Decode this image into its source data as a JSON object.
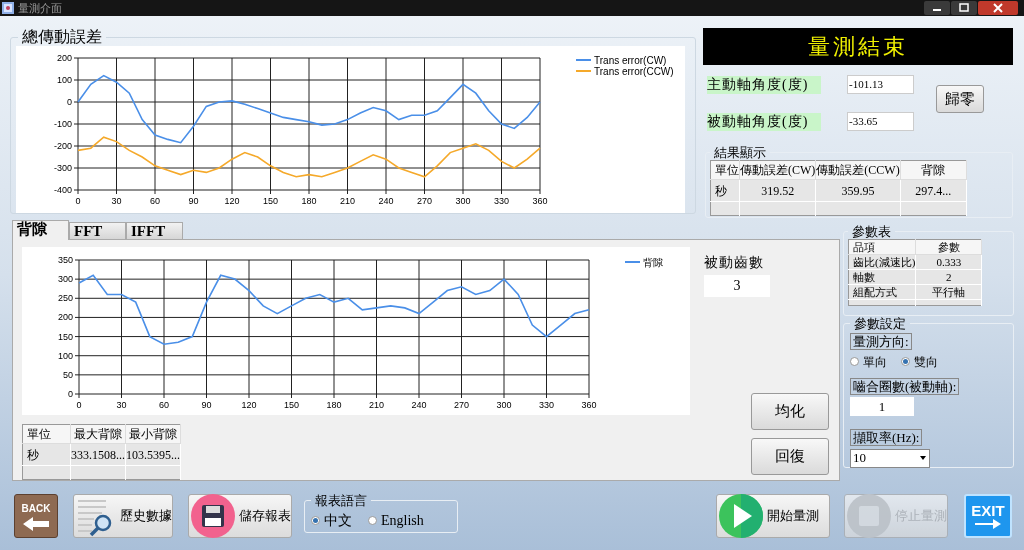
{
  "window": {
    "title": "量測介面"
  },
  "total_error": {
    "title": "總傳動誤差",
    "chart_data": {
      "type": "line",
      "grid": true,
      "legend": "right",
      "x": [
        0,
        10,
        20,
        30,
        40,
        50,
        60,
        70,
        80,
        90,
        100,
        110,
        120,
        130,
        140,
        150,
        160,
        170,
        180,
        190,
        200,
        210,
        220,
        230,
        240,
        250,
        260,
        270,
        280,
        290,
        300,
        310,
        320,
        330,
        340,
        350,
        360
      ],
      "xlim": [
        0,
        360
      ],
      "ylim": [
        -400,
        200
      ],
      "xticks": [
        0,
        30,
        60,
        90,
        120,
        150,
        180,
        210,
        240,
        270,
        300,
        330,
        360
      ],
      "yticks": [
        -400,
        -300,
        -200,
        -100,
        0,
        100,
        200
      ],
      "series": [
        {
          "name": "Trans error(CW)",
          "color": "#4a8fe8",
          "values": [
            0,
            80,
            120,
            90,
            40,
            -80,
            -150,
            -170,
            -185,
            -110,
            -20,
            0,
            5,
            -10,
            -30,
            -50,
            -70,
            -80,
            -90,
            -105,
            -100,
            -80,
            -50,
            -25,
            -40,
            -80,
            -60,
            -60,
            -40,
            20,
            80,
            40,
            -40,
            -100,
            -120,
            -70,
            0
          ]
        },
        {
          "name": "Trans error(CCW)",
          "color": "#f5a92a",
          "values": [
            -220,
            -210,
            -160,
            -180,
            -220,
            -250,
            -290,
            -310,
            -330,
            -310,
            -320,
            -300,
            -260,
            -230,
            -250,
            -290,
            -320,
            -340,
            -330,
            -340,
            -320,
            -300,
            -270,
            -240,
            -260,
            -300,
            -320,
            -340,
            -290,
            -230,
            -210,
            -190,
            -220,
            -270,
            -300,
            -260,
            -210
          ]
        }
      ]
    }
  },
  "status_banner": "量測結束",
  "angles": [
    {
      "label": "主動軸角度(度)",
      "value": "-101.13"
    },
    {
      "label": "被動軸角度(度)",
      "value": "-33.65"
    }
  ],
  "zero_button": "歸零",
  "results": {
    "title": "結果顯示",
    "columns": [
      "單位",
      "傳動誤差(CW)",
      "傳動誤差(CCW)",
      "背隙"
    ],
    "rows": [
      [
        "秒",
        "319.52",
        "359.95",
        "297.4..."
      ]
    ]
  },
  "tabs": [
    {
      "label": "背隙",
      "selected": true
    },
    {
      "label": "FFT",
      "selected": false
    },
    {
      "label": "IFFT",
      "selected": false
    }
  ],
  "backlash_chart": {
    "chart_data": {
      "type": "line",
      "grid": true,
      "legend": "right",
      "x": [
        0,
        10,
        20,
        30,
        40,
        50,
        60,
        70,
        80,
        90,
        100,
        110,
        120,
        130,
        140,
        150,
        160,
        170,
        180,
        190,
        200,
        210,
        220,
        230,
        240,
        250,
        260,
        270,
        280,
        290,
        300,
        310,
        320,
        330,
        340,
        350,
        360
      ],
      "xlim": [
        0,
        360
      ],
      "ylim": [
        0,
        350
      ],
      "xticks": [
        0,
        30,
        60,
        90,
        120,
        150,
        180,
        210,
        240,
        270,
        300,
        330,
        360
      ],
      "yticks": [
        0,
        50,
        100,
        150,
        200,
        250,
        300,
        350
      ],
      "series": [
        {
          "name": "背隙",
          "color": "#4a8fe8",
          "values": [
            290,
            310,
            260,
            260,
            240,
            150,
            130,
            135,
            150,
            240,
            310,
            300,
            270,
            230,
            210,
            230,
            250,
            260,
            240,
            250,
            220,
            225,
            230,
            225,
            210,
            240,
            270,
            280,
            260,
            270,
            300,
            260,
            180,
            150,
            180,
            210,
            220
          ]
        }
      ]
    }
  },
  "driven_teeth": {
    "label": "被動齒數",
    "value": "3"
  },
  "backlash_table": {
    "columns": [
      "單位",
      "最大背隙",
      "最小背隙"
    ],
    "rows": [
      [
        "秒",
        "333.1508...",
        "103.5395..."
      ]
    ]
  },
  "average_button": "均化",
  "restore_button": "回復",
  "param_table": {
    "title": "參數表",
    "columns": [
      "品項",
      "參數"
    ],
    "rows": [
      [
        "齒比(減速比)",
        "0.333"
      ],
      [
        "軸數",
        "2"
      ],
      [
        "組配方式",
        "平行軸"
      ]
    ]
  },
  "param_settings": {
    "title": "參數設定",
    "direction": {
      "label": "量測方向:",
      "options": [
        {
          "label": "單向",
          "selected": false
        },
        {
          "label": "雙向",
          "selected": true
        }
      ]
    },
    "mesh_turns": {
      "label": "嚙合圈數(被動軸):",
      "value": "1"
    },
    "sample_rate": {
      "label": "擷取率(Hz):",
      "value": "10"
    }
  },
  "toolbar": [
    {
      "kind": "back",
      "label": "BACK",
      "disabled": false
    },
    {
      "kind": "history",
      "label": "歷史數據",
      "disabled": false
    },
    {
      "kind": "save",
      "label": "儲存報表",
      "disabled": false
    }
  ],
  "report_language": {
    "title": "報表語言",
    "options": [
      {
        "label": "中文",
        "selected": true
      },
      {
        "label": "English",
        "selected": false
      }
    ]
  },
  "actions": [
    {
      "kind": "start",
      "label": "開始量測",
      "disabled": false
    },
    {
      "kind": "stop",
      "label": "停止量測",
      "disabled": true
    },
    {
      "kind": "exit",
      "label": "EXIT",
      "disabled": false
    }
  ]
}
